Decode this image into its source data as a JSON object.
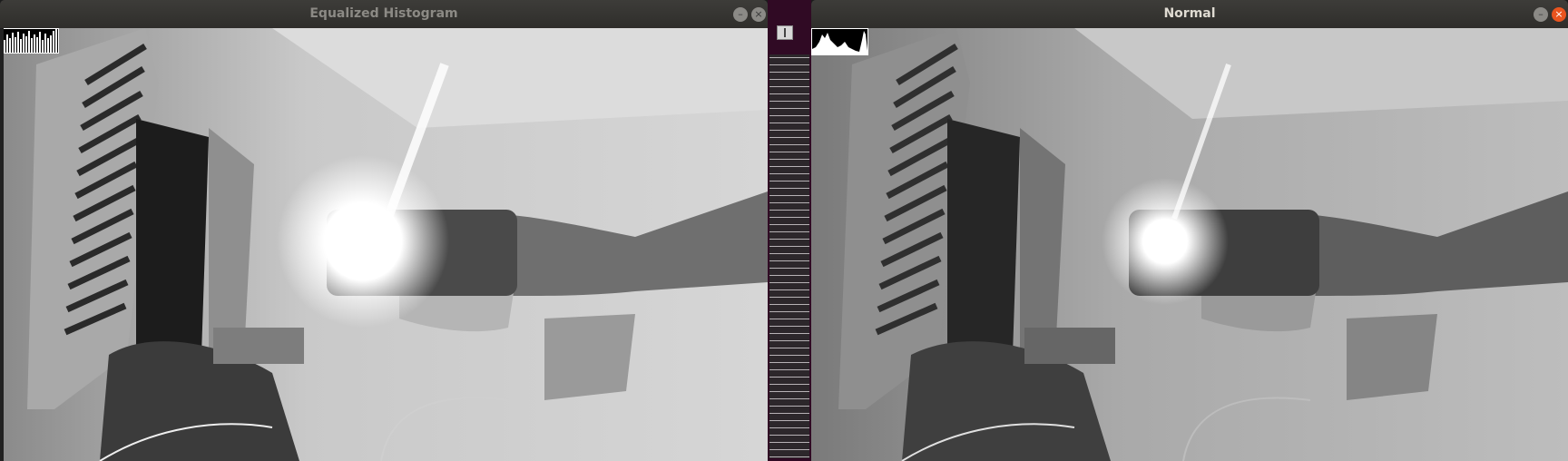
{
  "windows": {
    "left": {
      "title": "Equalized Histogram",
      "buttons": [
        "minimize-icon",
        "close-icon"
      ]
    },
    "right": {
      "title": "Normal",
      "buttons": [
        "minimize-icon",
        "close-icon"
      ]
    }
  },
  "terminal": {
    "icon": "split-view-icon"
  },
  "colors": {
    "titlebar": "#3a3936",
    "close_active": "#e9541f",
    "terminal_bg": "#300a24"
  }
}
